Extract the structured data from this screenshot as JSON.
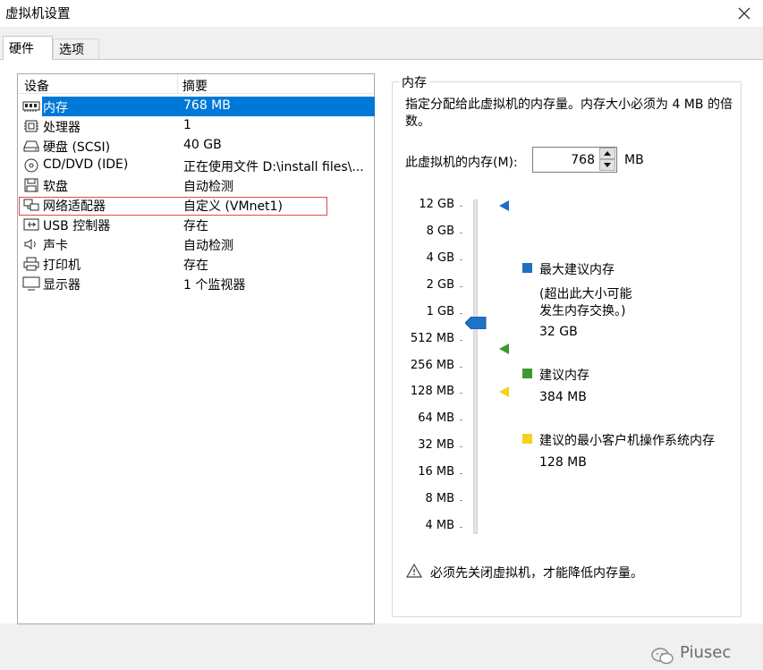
{
  "window": {
    "title": "虚拟机设置"
  },
  "tabs": [
    {
      "label": "硬件",
      "active": true
    },
    {
      "label": "选项",
      "active": false
    }
  ],
  "device_list": {
    "headers": {
      "device": "设备",
      "summary": "摘要"
    },
    "rows": [
      {
        "icon": "memory-icon",
        "name": "内存",
        "summary": "768 MB",
        "selected": true
      },
      {
        "icon": "processor-icon",
        "name": "处理器",
        "summary": "1"
      },
      {
        "icon": "hard-disk-icon",
        "name": "硬盘 (SCSI)",
        "summary": "40 GB"
      },
      {
        "icon": "cd-dvd-icon",
        "name": "CD/DVD (IDE)",
        "summary": "正在使用文件 D:\\install files\\..."
      },
      {
        "icon": "floppy-icon",
        "name": "软盘",
        "summary": "自动检测"
      },
      {
        "icon": "network-adapter-icon",
        "name": "网络适配器",
        "summary": "自定义 (VMnet1)",
        "highlighted": true
      },
      {
        "icon": "usb-icon",
        "name": "USB 控制器",
        "summary": "存在"
      },
      {
        "icon": "sound-icon",
        "name": "声卡",
        "summary": "自动检测"
      },
      {
        "icon": "printer-icon",
        "name": "打印机",
        "summary": "存在"
      },
      {
        "icon": "display-icon",
        "name": "显示器",
        "summary": "1 个监视器"
      }
    ]
  },
  "memory": {
    "group_title": "内存",
    "description": "指定分配给此虚拟机的内存量。内存大小必须为 4 MB 的倍数。",
    "field_label": "此虚拟机的内存(M):",
    "value": "768",
    "unit": "MB",
    "scale_ticks": [
      "12 GB",
      "8 GB",
      "4 GB",
      "2 GB",
      "1 GB",
      "512 MB",
      "256 MB",
      "128 MB",
      "64 MB",
      "32 MB",
      "16 MB",
      "8 MB",
      "4 MB"
    ],
    "legend": {
      "max": {
        "label": "最大建议内存",
        "note_line1": "(超出此大小可能",
        "note_line2": "发生内存交换。)",
        "value": "32 GB",
        "color": "#1e6fbf"
      },
      "recommended": {
        "label": "建议内存",
        "value": "384 MB",
        "color": "#3c9a2e"
      },
      "minimum": {
        "label": "建议的最小客户机操作系统内存",
        "value": "128 MB",
        "color": "#f3d21a"
      }
    },
    "warning": "必须先关闭虚拟机，才能降低内存量。"
  },
  "watermark": {
    "text": "Piusec"
  },
  "colors": {
    "selection": "#0078d7",
    "highlight_border": "#e0474c",
    "thumb": "#1e73c8"
  }
}
